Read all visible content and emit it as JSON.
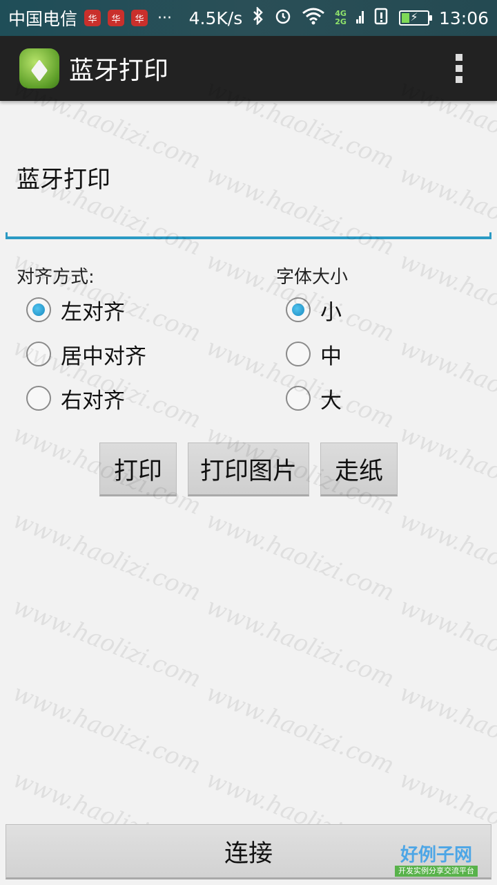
{
  "status_bar": {
    "carrier": "中国电信",
    "notif_glyph": "华",
    "more": "···",
    "speed": "4.5K/s",
    "net_4g": "4G",
    "net_2g": "2G",
    "time": "13:06",
    "battery_level": 0.3
  },
  "action_bar": {
    "title": "蓝牙打印",
    "icons": [
      "android-app-icon",
      "overflow-menu-icon"
    ]
  },
  "edit": {
    "value": "蓝牙打印"
  },
  "align_group": {
    "label": "对齐方式:",
    "options": [
      "左对齐",
      "居中对齐",
      "右对齐"
    ],
    "selected": "左对齐"
  },
  "size_group": {
    "label": "字体大小",
    "options": [
      "小",
      "中",
      "大"
    ],
    "selected": "小"
  },
  "buttons": {
    "print": "打印",
    "print_image": "打印图片",
    "feed": "走纸",
    "connect": "连接"
  },
  "colors": {
    "accent": "#2b9ac4",
    "action_bar": "#222222",
    "status_bar": "#244a52"
  },
  "watermark": {
    "logo_text": "好例子网",
    "logo_subtext": "开发实例分享交流平台",
    "tile_text": "www.haolizi.com"
  }
}
